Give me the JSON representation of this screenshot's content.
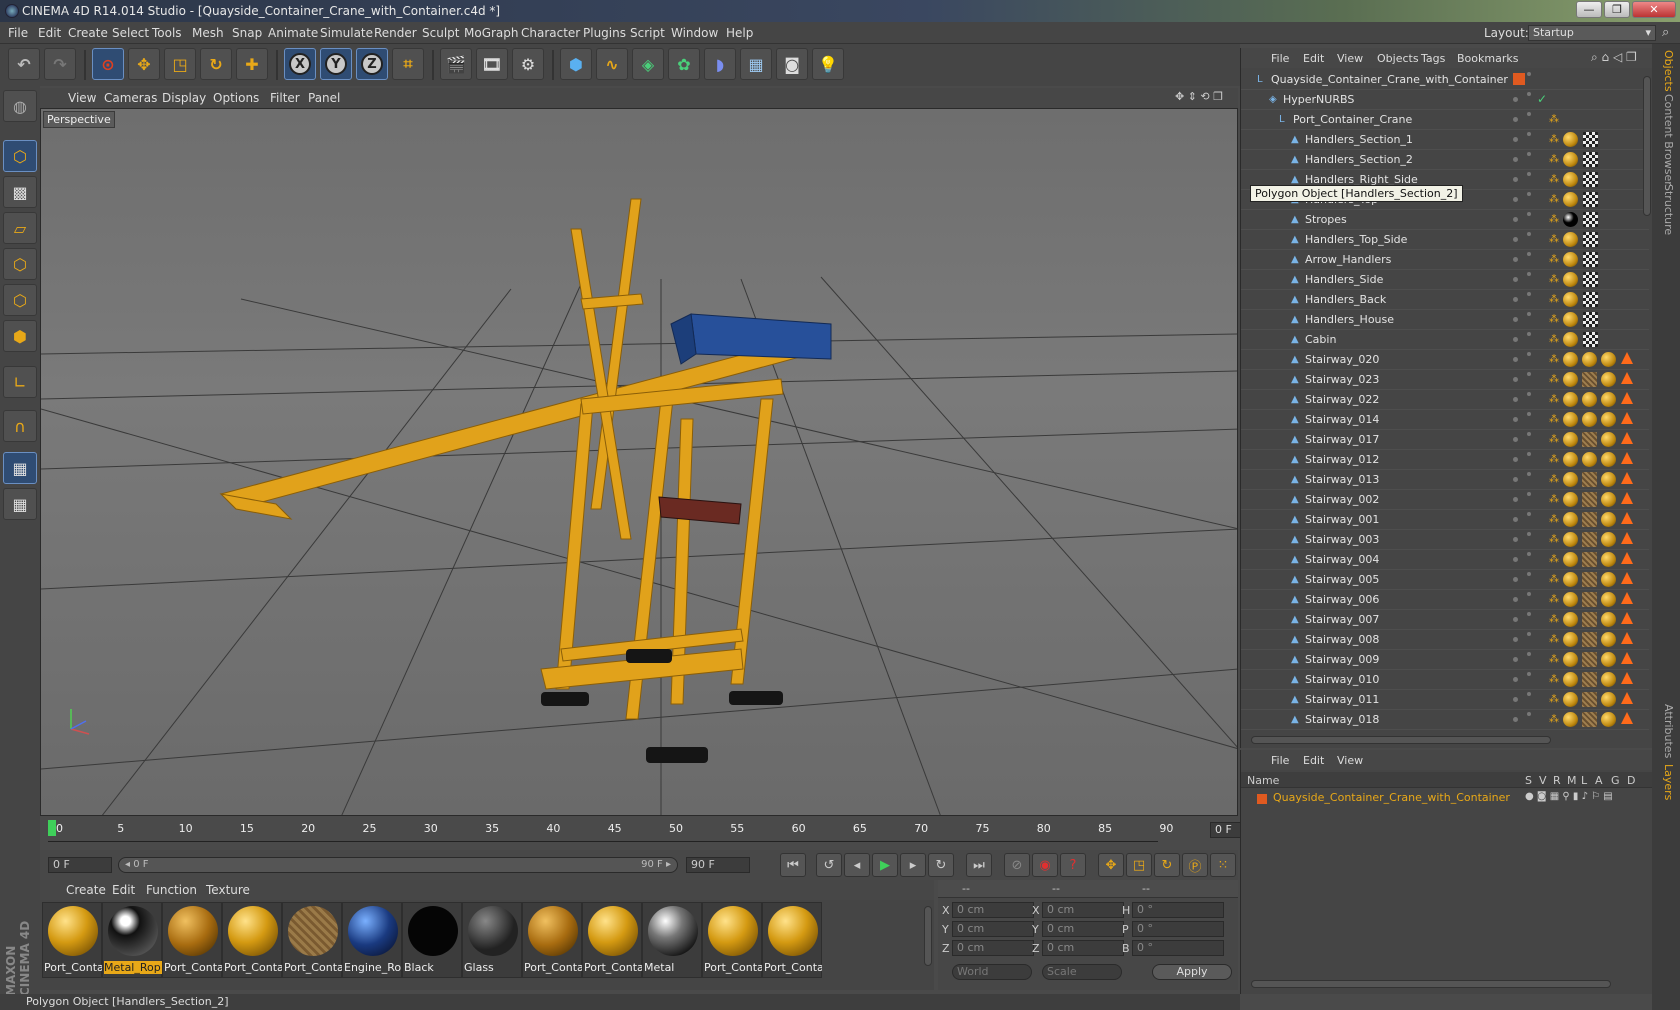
{
  "window": {
    "title": "CINEMA 4D R14.014 Studio - [Quayside_Container_Crane_with_Container.c4d *]",
    "min": "—",
    "max": "❐",
    "close": "✕"
  },
  "menubar": {
    "items": [
      "File",
      "Edit",
      "Create",
      "Select",
      "Tools",
      "Mesh",
      "Snap",
      "Animate",
      "Simulate",
      "Render",
      "Sculpt",
      "MoGraph",
      "Character",
      "Plugins",
      "Script",
      "Window",
      "Help"
    ],
    "layout_label": "Layout:",
    "layout_value": "Startup"
  },
  "viewport": {
    "menu": [
      "View",
      "Cameras",
      "Display",
      "Options",
      "Filter",
      "Panel"
    ],
    "label": "Perspective"
  },
  "timeline": {
    "ticks": [
      "0",
      "5",
      "10",
      "15",
      "20",
      "25",
      "30",
      "35",
      "40",
      "45",
      "50",
      "55",
      "60",
      "65",
      "70",
      "75",
      "80",
      "85",
      "90"
    ],
    "end_field": "0 F"
  },
  "transport": {
    "start": "0 F",
    "range_start": "◂ 0 F",
    "range_end": "90 F ▸",
    "end": "90 F"
  },
  "materials": {
    "menu": [
      "Create",
      "Edit",
      "Function",
      "Texture"
    ],
    "items": [
      {
        "label": "Port_Conta",
        "type": "gold"
      },
      {
        "label": "Metal_Rop",
        "type": "chrome",
        "selected": true
      },
      {
        "label": "Port_Conta",
        "type": "rust"
      },
      {
        "label": "Port_Conta",
        "type": "gold"
      },
      {
        "label": "Port_Conta",
        "type": "hatch"
      },
      {
        "label": "Engine_Ro",
        "type": "blue"
      },
      {
        "label": "Black",
        "type": "black"
      },
      {
        "label": "Glass",
        "type": "glass"
      },
      {
        "label": "Port_Conta",
        "type": "rust"
      },
      {
        "label": "Port_Conta",
        "type": "gold"
      },
      {
        "label": "Metal",
        "type": "steel"
      },
      {
        "label": "Port_Conta",
        "type": "gold"
      },
      {
        "label": "Port_Conta",
        "type": "gold"
      }
    ]
  },
  "coords": {
    "headers": [
      "--",
      "--",
      "--"
    ],
    "rows": [
      {
        "a": "X",
        "av": "0 cm",
        "b": "X",
        "bv": "0 cm",
        "c": "H",
        "cv": "0 °"
      },
      {
        "a": "Y",
        "av": "0 cm",
        "b": "Y",
        "bv": "0 cm",
        "c": "P",
        "cv": "0 °"
      },
      {
        "a": "Z",
        "av": "0 cm",
        "b": "Z",
        "bv": "0 cm",
        "c": "B",
        "cv": "0 °"
      }
    ],
    "mode": "World",
    "scale": "Scale",
    "apply": "Apply"
  },
  "status": "Polygon Object [Handlers_Section_2]",
  "objects": {
    "menu": [
      "File",
      "Edit",
      "View",
      "Objects",
      "Tags",
      "Bookmarks"
    ],
    "tooltip": "Polygon Object [Handlers_Section_2]",
    "items": [
      {
        "name": "Quayside_Container_Crane_with_Container",
        "depth": 0,
        "tags": "none"
      },
      {
        "name": "HyperNURBS",
        "depth": 1,
        "tags": "check"
      },
      {
        "name": "Port_Container_Crane",
        "depth": 2,
        "tags": "phong"
      },
      {
        "name": "Handlers_Section_1",
        "depth": 3,
        "tags": "gc"
      },
      {
        "name": "Handlers_Section_2",
        "depth": 3,
        "tags": "gc"
      },
      {
        "name": "Handlers_Right_Side",
        "depth": 3,
        "tags": "gc"
      },
      {
        "name": "Handlers_Top",
        "depth": 3,
        "tags": "gc"
      },
      {
        "name": "Stropes",
        "depth": 3,
        "tags": "bc"
      },
      {
        "name": "Handlers_Top_Side",
        "depth": 3,
        "tags": "gc"
      },
      {
        "name": "Arrow_Handlers",
        "depth": 3,
        "tags": "gc"
      },
      {
        "name": "Handlers_Side",
        "depth": 3,
        "tags": "gc"
      },
      {
        "name": "Handlers_Back",
        "depth": 3,
        "tags": "gc"
      },
      {
        "name": "Handlers_House",
        "depth": 3,
        "tags": "gc"
      },
      {
        "name": "Cabin",
        "depth": 3,
        "tags": "gc"
      },
      {
        "name": "Stairway_020",
        "depth": 3,
        "tags": "stair"
      },
      {
        "name": "Stairway_023",
        "depth": 3,
        "tags": "stair2"
      },
      {
        "name": "Stairway_022",
        "depth": 3,
        "tags": "stair"
      },
      {
        "name": "Stairway_014",
        "depth": 3,
        "tags": "stair"
      },
      {
        "name": "Stairway_017",
        "depth": 3,
        "tags": "stair2"
      },
      {
        "name": "Stairway_012",
        "depth": 3,
        "tags": "stair"
      },
      {
        "name": "Stairway_013",
        "depth": 3,
        "tags": "stair2"
      },
      {
        "name": "Stairway_002",
        "depth": 3,
        "tags": "stair2"
      },
      {
        "name": "Stairway_001",
        "depth": 3,
        "tags": "stair2"
      },
      {
        "name": "Stairway_003",
        "depth": 3,
        "tags": "stair2"
      },
      {
        "name": "Stairway_004",
        "depth": 3,
        "tags": "stair2"
      },
      {
        "name": "Stairway_005",
        "depth": 3,
        "tags": "stair2"
      },
      {
        "name": "Stairway_006",
        "depth": 3,
        "tags": "stair2"
      },
      {
        "name": "Stairway_007",
        "depth": 3,
        "tags": "stair2"
      },
      {
        "name": "Stairway_008",
        "depth": 3,
        "tags": "stair2"
      },
      {
        "name": "Stairway_009",
        "depth": 3,
        "tags": "stair2"
      },
      {
        "name": "Stairway_010",
        "depth": 3,
        "tags": "stair2"
      },
      {
        "name": "Stairway_011",
        "depth": 3,
        "tags": "stair2"
      },
      {
        "name": "Stairway_018",
        "depth": 3,
        "tags": "stair2"
      }
    ]
  },
  "layers": {
    "menu": [
      "File",
      "Edit",
      "View"
    ],
    "columns": [
      "Name",
      "S",
      "V",
      "R",
      "M",
      "L",
      "A",
      "G",
      "D"
    ],
    "row": "Quayside_Container_Crane_with_Container"
  },
  "right_tabs": [
    "Objects",
    "Content Browser",
    "Structure",
    "Attributes",
    "Layers"
  ],
  "colors": {
    "accent": "#e8a818",
    "selection": "#2f4c73",
    "warning": "#ff6a1a"
  }
}
